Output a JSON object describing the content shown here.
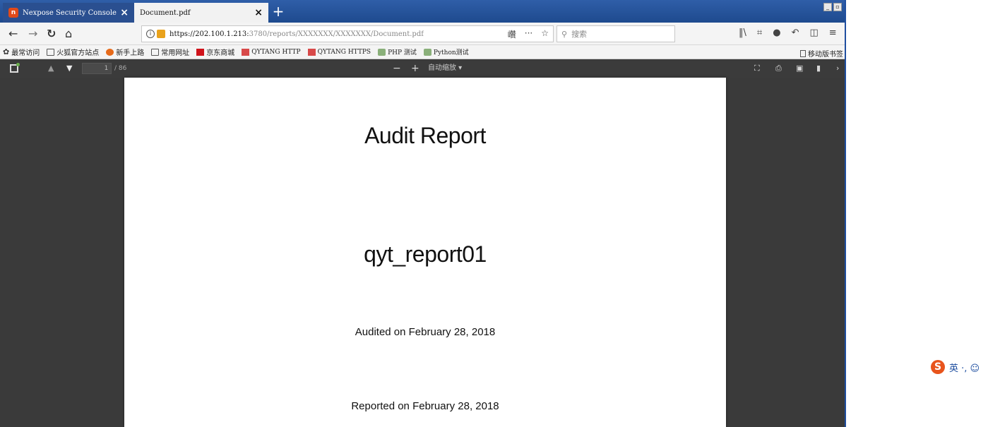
{
  "browser": {
    "tabs": [
      {
        "label": "Nexpose Security Console :",
        "favicon": "nexpose-icon",
        "active": false
      },
      {
        "label": "Document.pdf",
        "active": true
      }
    ],
    "new_tab_label": "+",
    "window_controls": [
      "_",
      "×"
    ]
  },
  "navbar": {
    "url_main": "https://202.100.1.213:",
    "url_path": "3780/reports/XXXXXXX/XXXXXXX/Document.pdf",
    "reader_mode_label": "巑",
    "more_label": "···",
    "bookmark_star": "☆",
    "search_placeholder": "搜索"
  },
  "bookmarks": [
    {
      "label": "最常访问",
      "icon": "gear-icon"
    },
    {
      "label": "火狐官方站点",
      "icon": "folder-icon"
    },
    {
      "label": "新手上路",
      "icon": "firefox-icon"
    },
    {
      "label": "常用网址",
      "icon": "folder-icon"
    },
    {
      "label": "京东商城",
      "icon": "jd-icon"
    },
    {
      "label": "QYTANG HTTP",
      "icon": "bookmark-icon"
    },
    {
      "label": "QYTANG HTTPS",
      "icon": "bookmark-icon"
    },
    {
      "label": "PHP 测试",
      "icon": "elephant-icon"
    },
    {
      "label": "Python测试",
      "icon": "elephant-icon"
    }
  ],
  "bookmarks_mobile": "移动版书签",
  "pdf_toolbar": {
    "page_current": "1",
    "page_total": "/ 86",
    "zoom_out": "−",
    "zoom_in": "+",
    "zoom_value": "自动缩放"
  },
  "document": {
    "title": "Audit Report",
    "report_name": "qyt_report01",
    "audited": "Audited on February 28, 2018",
    "reported": "Reported on February 28, 2018"
  },
  "ime": {
    "logo": "S",
    "text": "英 ·, ☺"
  }
}
